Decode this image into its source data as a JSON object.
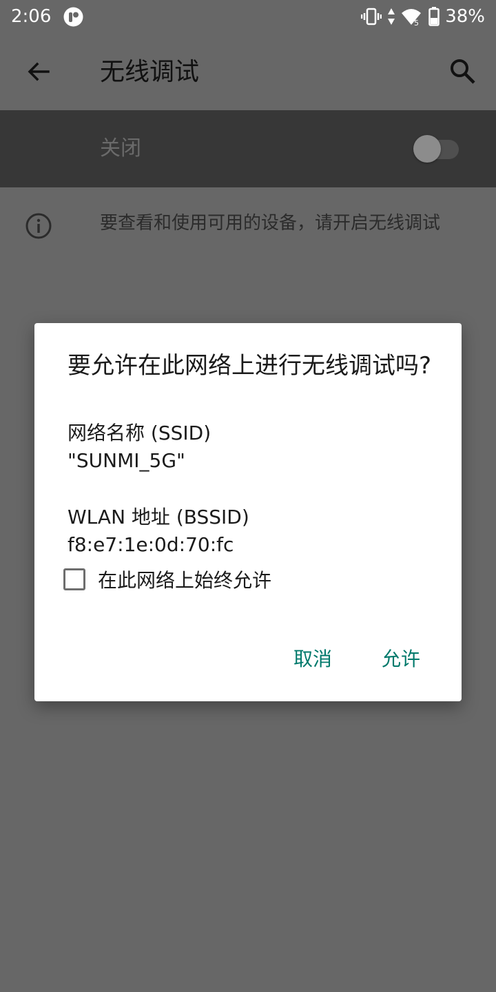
{
  "status_bar": {
    "time": "2:06",
    "battery_percent": "38%",
    "icons": [
      "app-notification-icon",
      "vibrate-icon",
      "data-arrows-icon",
      "wifi-5g-icon",
      "battery-icon"
    ]
  },
  "app_bar": {
    "title": "无线调试",
    "back_icon": "arrow-left-icon",
    "search_icon": "search-icon"
  },
  "master_switch": {
    "label": "关闭",
    "checked": false
  },
  "info": {
    "icon": "info-icon",
    "text": "要查看和使用可用的设备，请开启无线调试"
  },
  "dialog": {
    "title": "要允许在此网络上进行无线调试吗?",
    "network_name_label": "网络名称 (SSID)",
    "network_name_value": "\"SUNMI_5G\"",
    "bssid_label": "WLAN 地址 (BSSID)",
    "bssid_value": "f8:e7:1e:0d:70:fc",
    "always_allow_label": "在此网络上始终允许",
    "always_allow_checked": false,
    "cancel_label": "取消",
    "allow_label": "允许"
  },
  "colors": {
    "scrim_background": "#676767",
    "switch_row_background": "#373737",
    "accent": "#00796b"
  }
}
